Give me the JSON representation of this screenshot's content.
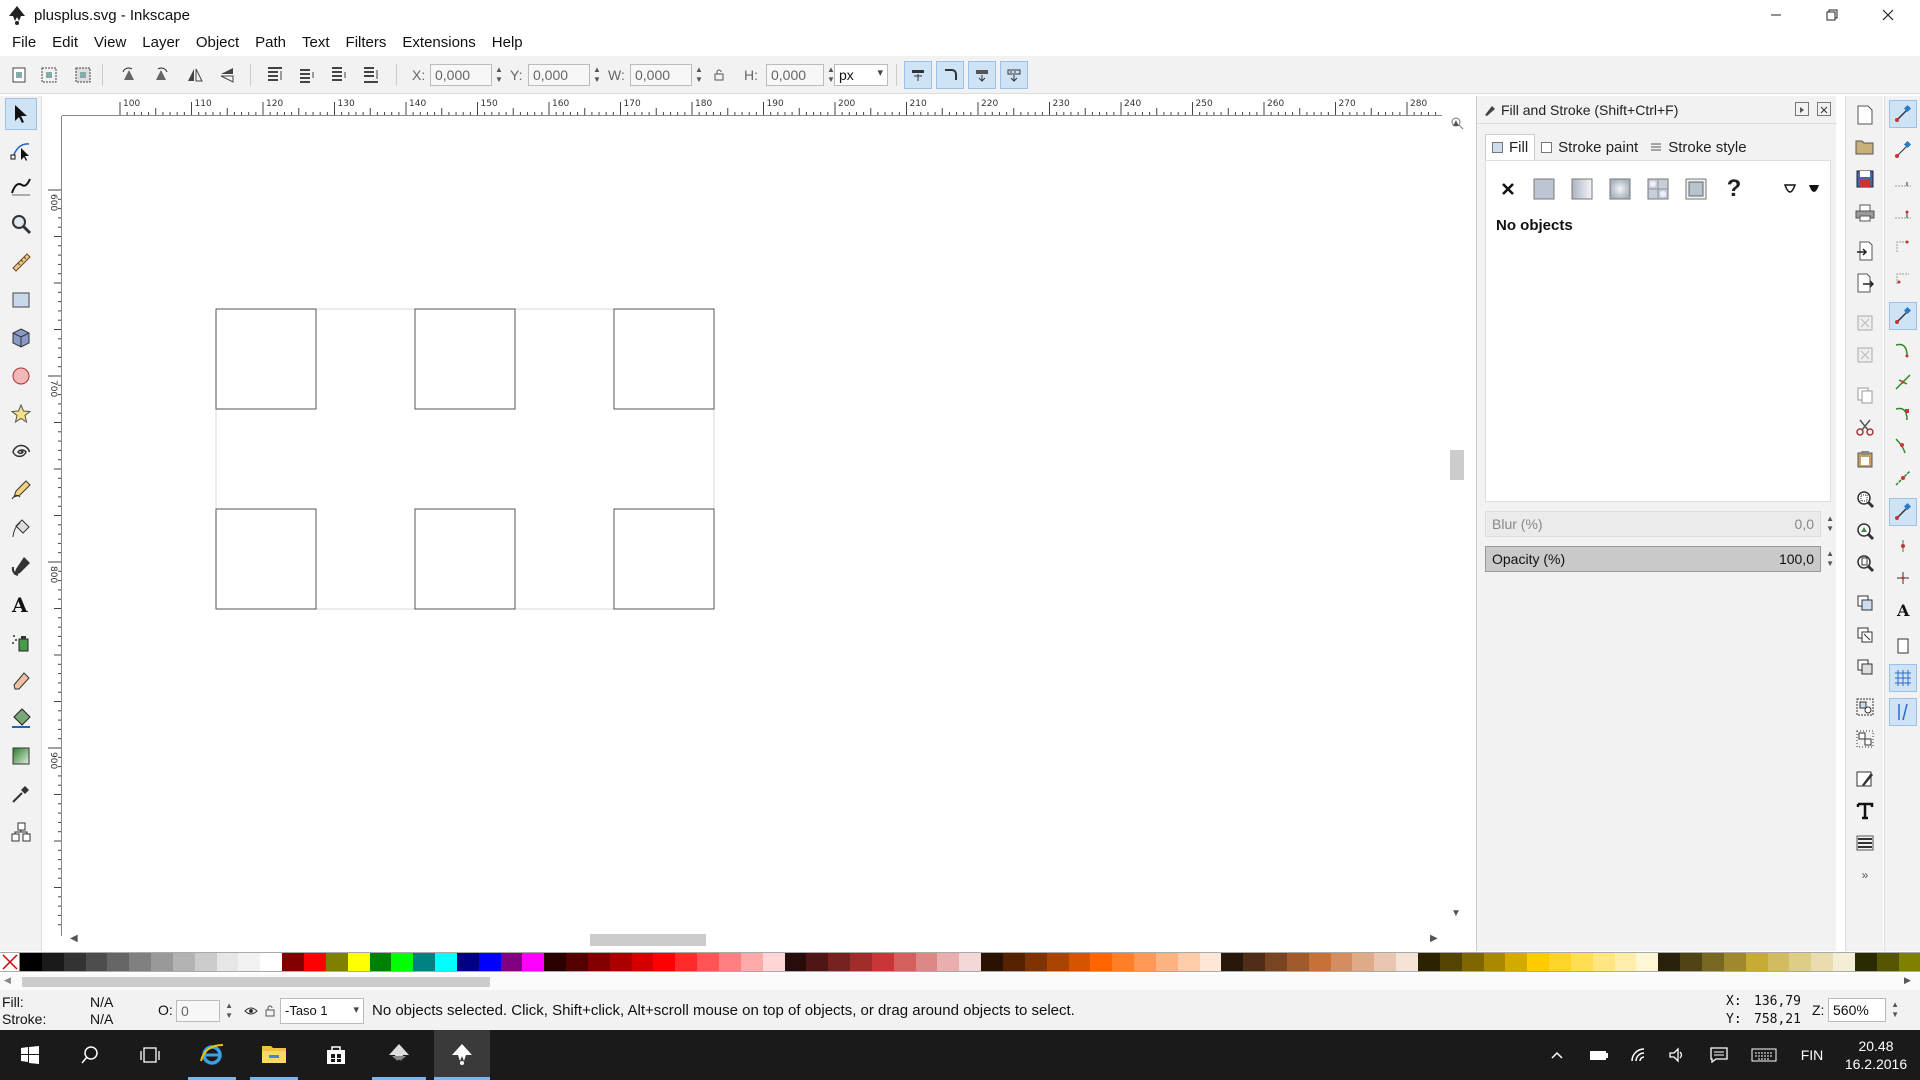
{
  "window": {
    "title": "plusplus.svg - Inkscape"
  },
  "menu": [
    "File",
    "Edit",
    "View",
    "Layer",
    "Object",
    "Path",
    "Text",
    "Filters",
    "Extensions",
    "Help"
  ],
  "toolbar": {
    "x_label": "X:",
    "x_value": "0,000",
    "y_label": "Y:",
    "y_value": "0,000",
    "w_label": "W:",
    "w_value": "0,000",
    "h_label": "H:",
    "h_value": "0,000",
    "unit": "px"
  },
  "ruler": {
    "h_labels": [
      "100",
      "110",
      "120",
      "130",
      "140",
      "150",
      "160",
      "170",
      "180",
      "190",
      "200",
      "210",
      "220",
      "230",
      "240",
      "250",
      "260",
      "270",
      "280"
    ],
    "v_labels": [
      "600",
      "700",
      "800",
      "900"
    ]
  },
  "canvas": {
    "grid": {
      "columns": 3,
      "rows": 2
    },
    "squares": [
      1,
      1,
      1,
      1,
      1,
      1
    ]
  },
  "fill_stroke": {
    "title": "Fill and Stroke (Shift+Ctrl+F)",
    "tabs": {
      "fill": "Fill",
      "stroke_paint": "Stroke paint",
      "stroke_style": "Stroke style"
    },
    "message": "No objects",
    "blur_label": "Blur (%)",
    "blur_value": "0,0",
    "opacity_label": "Opacity (%)",
    "opacity_value": "100,0",
    "unknown_glyph": "?"
  },
  "palette": {
    "colors": [
      "#000000",
      "#1a1a1a",
      "#333333",
      "#4d4d4d",
      "#666666",
      "#808080",
      "#999999",
      "#b3b3b3",
      "#cccccc",
      "#e6e6e6",
      "#f2f2f2",
      "#ffffff",
      "#800000",
      "#ff0000",
      "#808000",
      "#ffff00",
      "#008000",
      "#00ff00",
      "#008080",
      "#00ffff",
      "#000080",
      "#0000ff",
      "#800080",
      "#ff00ff",
      "#2b0000",
      "#550000",
      "#800000",
      "#aa0000",
      "#d40000",
      "#ff0000",
      "#ff2a2a",
      "#ff5555",
      "#ff8080",
      "#ffaaaa",
      "#ffd5d5",
      "#280b0b",
      "#501616",
      "#782121",
      "#a02c2c",
      "#c83737",
      "#d35f5f",
      "#de8787",
      "#e9afaf",
      "#f4d7d7",
      "#2b1100",
      "#552200",
      "#803300",
      "#aa4400",
      "#d45500",
      "#ff6600",
      "#ff7f2a",
      "#ff9955",
      "#ffb380",
      "#ffccaa",
      "#ffe6d5",
      "#28170b",
      "#502d16",
      "#784421",
      "#a05a2c",
      "#c87137",
      "#d38d5f",
      "#deaa87",
      "#e9c6af",
      "#f4e3d7",
      "#2b2200",
      "#554400",
      "#806600",
      "#aa8800",
      "#d4aa00",
      "#ffcc00",
      "#ffd42a",
      "#ffdd55",
      "#ffe680",
      "#ffeeaa",
      "#fff6d5",
      "#28220b",
      "#504416",
      "#786721",
      "#a0892c",
      "#c8ab37",
      "#d3bc5f",
      "#decd87",
      "#e9ddaf",
      "#f4eed7",
      "#2b2b00",
      "#555500",
      "#808000"
    ]
  },
  "status": {
    "fill_label": "Fill:",
    "fill_value": "N/A",
    "stroke_label": "Stroke:",
    "stroke_value": "N/A",
    "opacity_label": "O:",
    "opacity_value": "0",
    "layer": "-Taso 1",
    "message": "No objects selected. Click, Shift+click, Alt+scroll mouse on top of objects, or drag around objects to select.",
    "x_label": "X:",
    "x_value": "136,79",
    "y_label": "Y:",
    "y_value": "758,21",
    "zoom_label": "Z:",
    "zoom_value": "560%"
  },
  "taskbar": {
    "language": "FIN",
    "time": "20.48",
    "date": "16.2.2016"
  }
}
